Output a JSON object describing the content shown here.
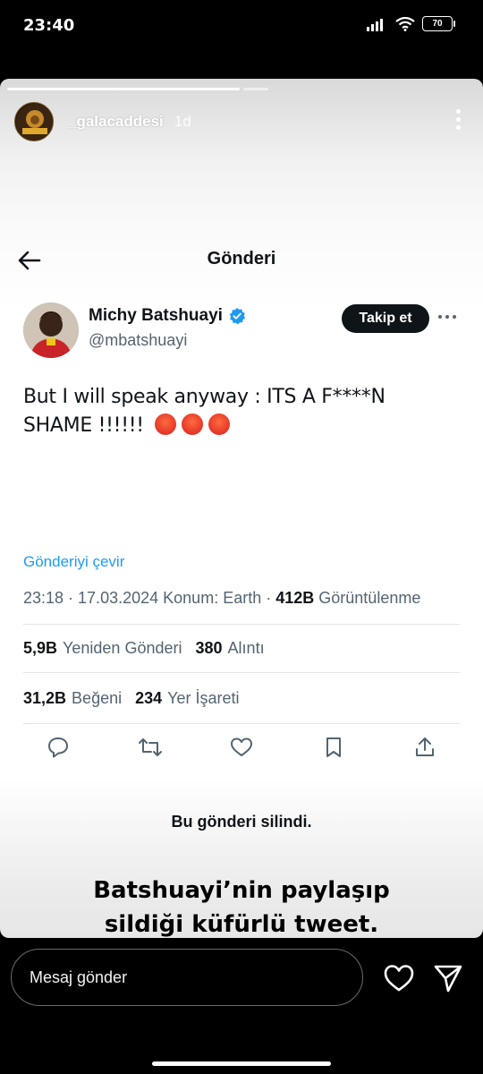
{
  "status_bar": {
    "time": "23:40",
    "battery": "70"
  },
  "story": {
    "username": "_galacaddesi",
    "age": "1d"
  },
  "tweet_page": {
    "title": "Gönderi",
    "author": {
      "name": "Michy Batshuayi",
      "handle": "@mbatshuayi"
    },
    "follow_label": "Takip et",
    "text_line1": "But I will speak anyway : ITS A F****N",
    "text_line2": "SHAME !!!!!!",
    "translate_label": "Gönderiyi çevir",
    "meta": {
      "time_date": "23:18 · 17.03.2024",
      "location": "Konum: Earth ·",
      "views_count": "412B",
      "views_label": "Görüntülenme"
    },
    "stats": {
      "reposts_count": "5,9B",
      "reposts_label": "Yeniden Gönderi",
      "quotes_count": "380",
      "quotes_label": "Alıntı",
      "likes_count": "31,2B",
      "likes_label": "Beğeni",
      "bookmarks_count": "234",
      "bookmarks_label": "Yer İşareti"
    },
    "deleted_notice": "Bu gönderi silindi."
  },
  "caption": {
    "line1": "Batshuayi’nin paylaşıp",
    "line2": "sildiği küfürlü tweet."
  },
  "reply_bar": {
    "placeholder": "Mesaj gönder"
  },
  "colors": {
    "accent_link": "#1d9bf0",
    "verified": "#1d9bf0",
    "follow_bg": "#0f1419"
  },
  "icons": [
    "signal-icon",
    "wifi-icon",
    "battery-icon",
    "back-arrow-icon",
    "verified-badge-icon",
    "reply-icon",
    "repost-icon",
    "like-icon",
    "bookmark-icon",
    "share-icon",
    "heart-icon",
    "send-icon"
  ]
}
